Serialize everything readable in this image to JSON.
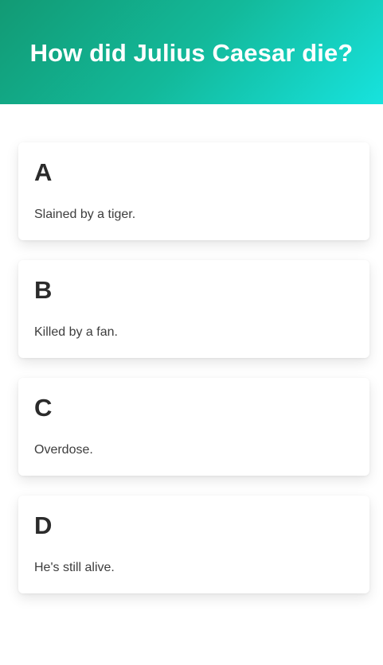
{
  "header": {
    "question": "How did Julius Caesar die?"
  },
  "options": [
    {
      "letter": "A",
      "text": "Slained by a tiger."
    },
    {
      "letter": "B",
      "text": "Killed by a fan."
    },
    {
      "letter": "C",
      "text": "Overdose."
    },
    {
      "letter": "D",
      "text": "He's still alive."
    }
  ],
  "colors": {
    "header_gradient_start": "#129a74",
    "header_gradient_end": "#17e3de",
    "title_text": "#ffffff",
    "card_background": "#ffffff",
    "letter_text": "#2b2b2b",
    "answer_text": "#3d3d3d"
  }
}
